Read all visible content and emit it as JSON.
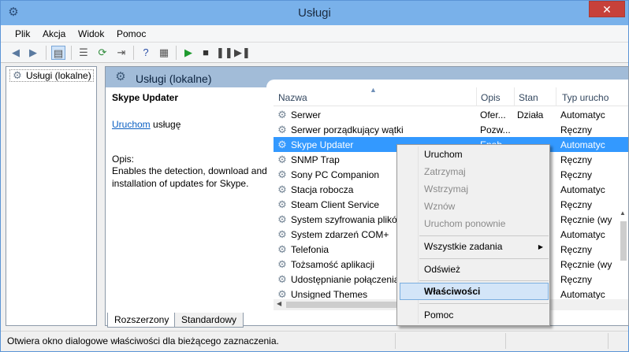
{
  "window": {
    "title": "Usługi",
    "close_label": "✕"
  },
  "menu": [
    "Plik",
    "Akcja",
    "Widok",
    "Pomoc"
  ],
  "tree": {
    "item": "Usługi (lokalne)"
  },
  "pane": {
    "title": "Usługi (lokalne)"
  },
  "detail": {
    "service_name": "Skype Updater",
    "start_link": "Uruchom",
    "start_suffix": "usługę",
    "desc_label": "Opis:",
    "description": "Enables the detection, download and installation of updates for Skype."
  },
  "columns": {
    "name": "Nazwa",
    "desc": "Opis",
    "status": "Stan",
    "type": "Typ urucho"
  },
  "rows": [
    {
      "name": "Serwer",
      "desc": "Ofer...",
      "status": "Działa",
      "type": "Automatyc"
    },
    {
      "name": "Serwer porządkujący wątki",
      "desc": "Pozw...",
      "status": "",
      "type": "Ręczny"
    },
    {
      "name": "Skype Updater",
      "desc": "Enab...",
      "status": "",
      "type": "Automatyc"
    },
    {
      "name": "SNMP Trap",
      "desc": "",
      "status": "",
      "type": "Ręczny"
    },
    {
      "name": "Sony PC Companion",
      "desc": "",
      "status": "",
      "type": "Ręczny"
    },
    {
      "name": "Stacja robocza",
      "desc": "",
      "status": "",
      "type": "Automatyc"
    },
    {
      "name": "Steam Client Service",
      "desc": "",
      "status": "",
      "type": "Ręczny"
    },
    {
      "name": "System szyfrowania plików",
      "desc": "",
      "status": "",
      "type": "Ręcznie (wy"
    },
    {
      "name": "System zdarzeń COM+",
      "desc": "",
      "status": "",
      "type": "Automatyc"
    },
    {
      "name": "Telefonia",
      "desc": "",
      "status": "",
      "type": "Ręczny"
    },
    {
      "name": "Tożsamość aplikacji",
      "desc": "",
      "status": "",
      "type": "Ręcznie (wy"
    },
    {
      "name": "Udostępnianie połączenia",
      "desc": "",
      "status": "",
      "type": "Ręczny"
    },
    {
      "name": "Unsigned Themes",
      "desc": "",
      "status": "",
      "type": "Automatyc"
    }
  ],
  "tabs": {
    "extended": "Rozszerzony",
    "standard": "Standardowy"
  },
  "status_text": "Otwiera okno dialogowe właściwości dla bieżącego zaznaczenia.",
  "context_menu": {
    "start": "Uruchom",
    "stop": "Zatrzymaj",
    "pause": "Wstrzymaj",
    "resume": "Wznów",
    "restart": "Uruchom ponownie",
    "all_tasks": "Wszystkie zadania",
    "refresh": "Odśwież",
    "properties": "Właściwości",
    "help": "Pomoc"
  },
  "colors": {
    "titlebar": "#79b1ea",
    "selection": "#3399ff",
    "close": "#c7413a"
  }
}
